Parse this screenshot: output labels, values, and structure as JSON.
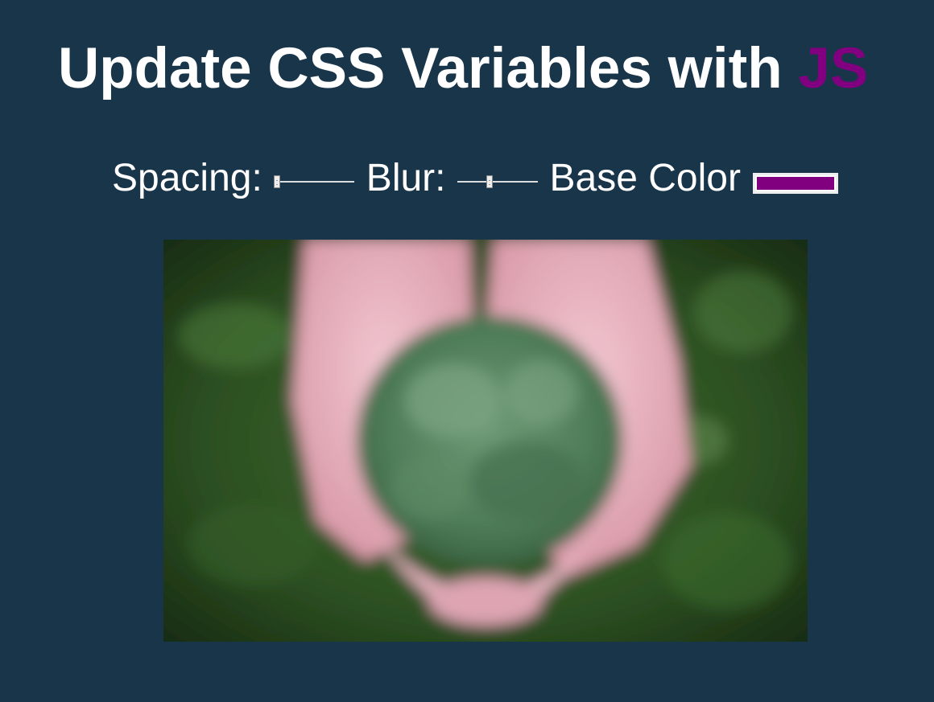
{
  "title": {
    "text": "Update CSS Variables with ",
    "highlight": "JS"
  },
  "controls": {
    "spacing_label": "Spacing:",
    "spacing_value": 10,
    "spacing_min": 10,
    "spacing_max": 200,
    "blur_label": "Blur:",
    "blur_value": 10,
    "blur_min": 0,
    "blur_max": 25,
    "base_color_label": "Base Color",
    "base_color_value": "#800080"
  },
  "colors": {
    "background": "#193549",
    "base": "#800080",
    "text": "#ffffff"
  },
  "image": {
    "subject": "hands holding leaves over grass"
  }
}
